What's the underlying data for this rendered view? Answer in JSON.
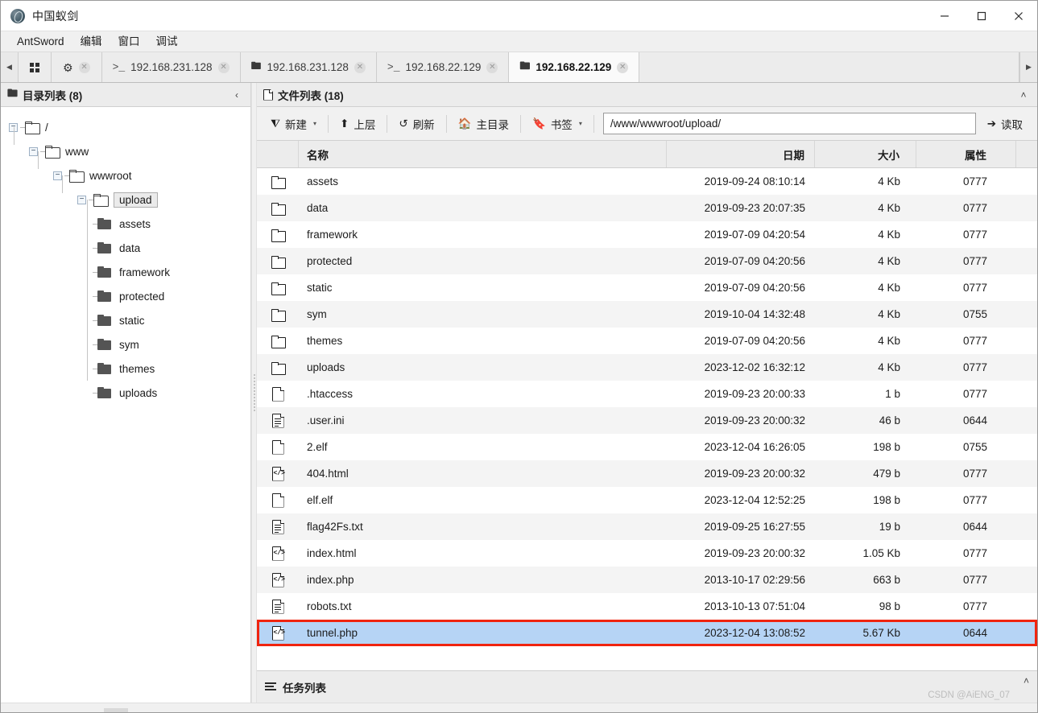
{
  "window": {
    "title": "中国蚁剑",
    "app_icon": "antsword-logo-icon",
    "minimize": "—",
    "maximize": "☐",
    "close": "✕"
  },
  "menubar": {
    "items": [
      {
        "label": "AntSword"
      },
      {
        "label": "编辑"
      },
      {
        "label": "窗口"
      },
      {
        "label": "调试"
      }
    ]
  },
  "tabstrip": {
    "scroll_left": "◀",
    "scroll_right": "▶",
    "tabs": [
      {
        "label": "",
        "icon": "grid-icon",
        "closable": false,
        "active": false
      },
      {
        "label": "",
        "icon": "gear-icon",
        "closable": true,
        "active": false
      },
      {
        "label": "192.168.231.128",
        "icon": "terminal-icon",
        "closable": true,
        "active": false
      },
      {
        "label": "192.168.231.128",
        "icon": "folder-icon",
        "closable": true,
        "active": false
      },
      {
        "label": "192.168.22.129",
        "icon": "terminal-icon",
        "closable": true,
        "active": false
      },
      {
        "label": "192.168.22.129",
        "icon": "folder-icon",
        "closable": true,
        "active": true
      }
    ],
    "close_glyph": "✕"
  },
  "sidebar": {
    "header": {
      "icon": "folder-icon",
      "title": "目录列表 (8)",
      "collapse": "‹"
    },
    "tree": [
      {
        "label": "/",
        "depth": 0,
        "expander": "−",
        "folder": "outline",
        "selected": false
      },
      {
        "label": "www",
        "depth": 1,
        "expander": "−",
        "folder": "outline",
        "selected": false
      },
      {
        "label": "wwwroot",
        "depth": 2,
        "expander": "−",
        "folder": "outline",
        "selected": false
      },
      {
        "label": "upload",
        "depth": 3,
        "expander": "−",
        "folder": "outline",
        "selected": true
      },
      {
        "label": "assets",
        "depth": 4,
        "expander": "",
        "folder": "solid",
        "selected": false
      },
      {
        "label": "data",
        "depth": 4,
        "expander": "",
        "folder": "solid",
        "selected": false
      },
      {
        "label": "framework",
        "depth": 4,
        "expander": "",
        "folder": "solid",
        "selected": false
      },
      {
        "label": "protected",
        "depth": 4,
        "expander": "",
        "folder": "solid",
        "selected": false
      },
      {
        "label": "static",
        "depth": 4,
        "expander": "",
        "folder": "solid",
        "selected": false
      },
      {
        "label": "sym",
        "depth": 4,
        "expander": "",
        "folder": "solid",
        "selected": false
      },
      {
        "label": "themes",
        "depth": 4,
        "expander": "",
        "folder": "solid",
        "selected": false
      },
      {
        "label": "uploads",
        "depth": 4,
        "expander": "",
        "folder": "solid",
        "selected": false
      }
    ]
  },
  "main": {
    "header": {
      "icon": "file-icon",
      "title": "文件列表 (18)",
      "collapse": "˄"
    },
    "toolbar": {
      "new_label": "新建",
      "new_icon": "plus-circle-icon",
      "up_label": "上层",
      "up_icon": "arrow-up-icon",
      "refresh_label": "刷新",
      "refresh_icon": "refresh-icon",
      "home_label": "主目录",
      "home_icon": "home-icon",
      "bookmark_label": "书签",
      "bookmark_icon": "bookmark-icon",
      "caret": "▾",
      "path_value": "/www/wwwroot/upload/",
      "path_placeholder": "/www/wwwroot/upload/",
      "read_label": "读取",
      "read_icon": "arrow-right-icon"
    },
    "columns": {
      "name": "名称",
      "date": "日期",
      "size": "大小",
      "attr": "属性"
    },
    "rows": [
      {
        "icon": "folder-icon",
        "name": "assets",
        "date": "2019-09-24 08:10:14",
        "size": "4 Kb",
        "attr": "0777",
        "selected": false
      },
      {
        "icon": "folder-icon",
        "name": "data",
        "date": "2019-09-23 20:07:35",
        "size": "4 Kb",
        "attr": "0777",
        "selected": false
      },
      {
        "icon": "folder-icon",
        "name": "framework",
        "date": "2019-07-09 04:20:54",
        "size": "4 Kb",
        "attr": "0777",
        "selected": false
      },
      {
        "icon": "folder-icon",
        "name": "protected",
        "date": "2019-07-09 04:20:56",
        "size": "4 Kb",
        "attr": "0777",
        "selected": false
      },
      {
        "icon": "folder-icon",
        "name": "static",
        "date": "2019-07-09 04:20:56",
        "size": "4 Kb",
        "attr": "0777",
        "selected": false
      },
      {
        "icon": "folder-icon",
        "name": "sym",
        "date": "2019-10-04 14:32:48",
        "size": "4 Kb",
        "attr": "0755",
        "selected": false
      },
      {
        "icon": "folder-icon",
        "name": "themes",
        "date": "2019-07-09 04:20:56",
        "size": "4 Kb",
        "attr": "0777",
        "selected": false
      },
      {
        "icon": "folder-icon",
        "name": "uploads",
        "date": "2023-12-02 16:32:12",
        "size": "4 Kb",
        "attr": "0777",
        "selected": false
      },
      {
        "icon": "file-icon",
        "name": ".htaccess",
        "date": "2019-09-23 20:00:33",
        "size": "1 b",
        "attr": "0777",
        "selected": false
      },
      {
        "icon": "document-icon",
        "name": ".user.ini",
        "date": "2019-09-23 20:00:32",
        "size": "46 b",
        "attr": "0644",
        "selected": false
      },
      {
        "icon": "file-icon",
        "name": "2.elf",
        "date": "2023-12-04 16:26:05",
        "size": "198 b",
        "attr": "0755",
        "selected": false
      },
      {
        "icon": "code-file-icon",
        "name": "404.html",
        "date": "2019-09-23 20:00:32",
        "size": "479 b",
        "attr": "0777",
        "selected": false
      },
      {
        "icon": "file-icon",
        "name": "elf.elf",
        "date": "2023-12-04 12:52:25",
        "size": "198 b",
        "attr": "0777",
        "selected": false
      },
      {
        "icon": "document-icon",
        "name": "flag42Fs.txt",
        "date": "2019-09-25 16:27:55",
        "size": "19 b",
        "attr": "0644",
        "selected": false
      },
      {
        "icon": "code-file-icon",
        "name": "index.html",
        "date": "2019-09-23 20:00:32",
        "size": "1.05 Kb",
        "attr": "0777",
        "selected": false
      },
      {
        "icon": "code-file-icon",
        "name": "index.php",
        "date": "2013-10-17 02:29:56",
        "size": "663 b",
        "attr": "0777",
        "selected": false
      },
      {
        "icon": "document-icon",
        "name": "robots.txt",
        "date": "2013-10-13 07:51:04",
        "size": "98 b",
        "attr": "0777",
        "selected": false
      },
      {
        "icon": "code-file-icon",
        "name": "tunnel.php",
        "date": "2023-12-04 13:08:52",
        "size": "5.67 Kb",
        "attr": "0644",
        "selected": true
      }
    ]
  },
  "taskpanel": {
    "icon": "list-icon",
    "title": "任务列表",
    "collapse": "˄",
    "watermark": "CSDN @AiENG_07"
  },
  "colors": {
    "selection_bg": "#b6d4f5",
    "selection_border": "#f0240f",
    "panel_bg": "#ececec",
    "row_alt": "#f4f4f4"
  }
}
